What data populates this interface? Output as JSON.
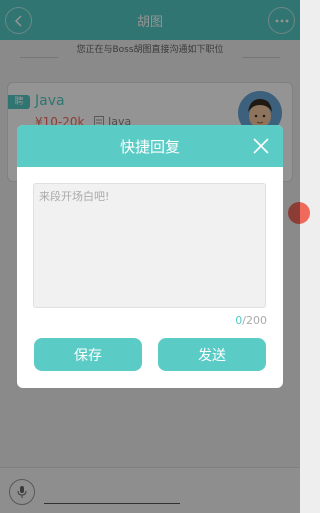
{
  "header": {
    "title": "胡图",
    "back_icon": "chevron-left-icon",
    "more_icon": "ellipsis-icon",
    "color": "#53cac3"
  },
  "notice": {
    "text": "您正在与Boss胡图直接沟通如下职位"
  },
  "job": {
    "badge": "聘",
    "title": "Java",
    "salary": "¥10-20k",
    "tag": "Java",
    "salary_color": "#f06a5c"
  },
  "quick_reply": {
    "title": "快捷回复",
    "placeholder": "来段开场白吧!",
    "value": "",
    "count_current": "0",
    "count_max": "/200",
    "save_label": "保存",
    "send_label": "发送",
    "accent": "#5bcbc6"
  },
  "bottom": {
    "mic_icon": "microphone-icon"
  }
}
